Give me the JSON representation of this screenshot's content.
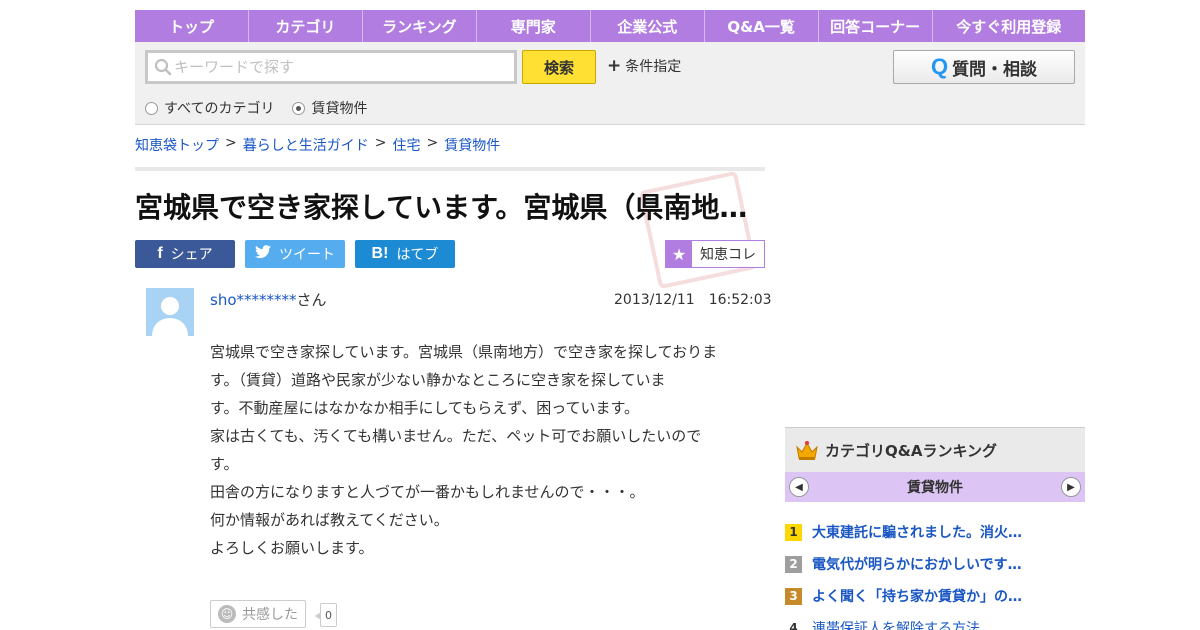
{
  "nav": {
    "items": [
      "トップ",
      "カテゴリ",
      "ランキング",
      "専門家",
      "企業公式",
      "Q&A一覧",
      "回答コーナー",
      "今すぐ利用登録"
    ]
  },
  "search": {
    "placeholder": "キーワードで探す",
    "button_label": "検索",
    "condition_label": "条件指定",
    "ask_label": "質問・相談",
    "scope_all": "すべてのカテゴリ",
    "scope_current": "賃貸物件",
    "selected_scope": "賃貸物件"
  },
  "breadcrumb": {
    "items": [
      "知恵袋トップ",
      "暮らしと生活ガイド",
      "住宅",
      "賃貸物件"
    ],
    "separator": ">"
  },
  "question": {
    "title": "宮城県で空き家探しています。宮城県（県南地…",
    "user": "sho********",
    "user_suffix": "さん",
    "date": "2013/12/11　16:52:03",
    "body": [
      "宮城県で空き家探しています。宮城県（県南地方）で空き家を探しておりま",
      "す。（賃貸）道路や民家が少ない静かなところに空き家を探していま",
      "す。不動産屋にはなかなか相手にしてもらえず、困っています。",
      "家は古くても、汚くても構いません。ただ、ペット可でお願いしたいので",
      "す。",
      "田舎の方になりますと人づてが一番かもしれませんので・・・。",
      "何か情報があれば教えてください。",
      "よろしくお願いします。"
    ],
    "empathy_label": "共感した",
    "empathy_count": "0"
  },
  "share": {
    "facebook": "シェア",
    "twitter": "ツイート",
    "hatena": "はてブ",
    "chiecolle": "知恵コレ"
  },
  "ranking": {
    "title": "カテゴリQ&Aランキング",
    "category": "賃貸物件",
    "items": [
      {
        "rank": "1",
        "title": "大東建託に騙されました。消火…"
      },
      {
        "rank": "2",
        "title": "電気代が明らかにおかしいです…"
      },
      {
        "rank": "3",
        "title": "よく聞く「持ち家か賃貸か」の…"
      },
      {
        "rank": "4",
        "title": "連帯保証人を解除する方法 …"
      }
    ]
  },
  "colors": {
    "nav_purple": "#b27de0",
    "link_blue": "#1a57c4",
    "search_yellow": "#ffe033",
    "facebook": "#3b5998",
    "twitter": "#55acee",
    "hatena": "#1d8ad4"
  }
}
